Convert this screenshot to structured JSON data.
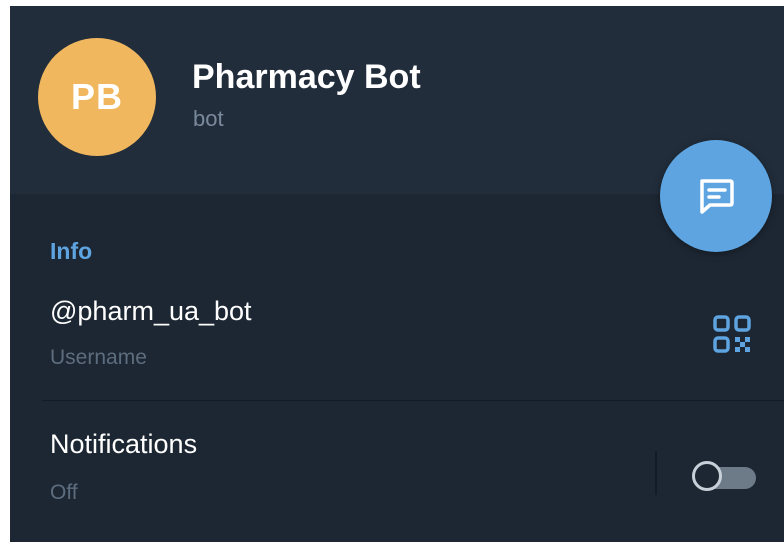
{
  "profile": {
    "initials": "PB",
    "name": "Pharmacy Bot",
    "type": "bot",
    "avatar_color": "#f0b75e"
  },
  "fab": {
    "icon": "message-icon",
    "color": "#5ea4e0"
  },
  "info": {
    "section_title": "Info",
    "username": {
      "value": "@pharm_ua_bot",
      "label": "Username",
      "icon": "qr-code-icon"
    },
    "notifications": {
      "title": "Notifications",
      "status": "Off",
      "toggle_on": false
    }
  },
  "colors": {
    "background": "#1d2733",
    "header": "#212d3b",
    "accent": "#5ea4e0"
  }
}
